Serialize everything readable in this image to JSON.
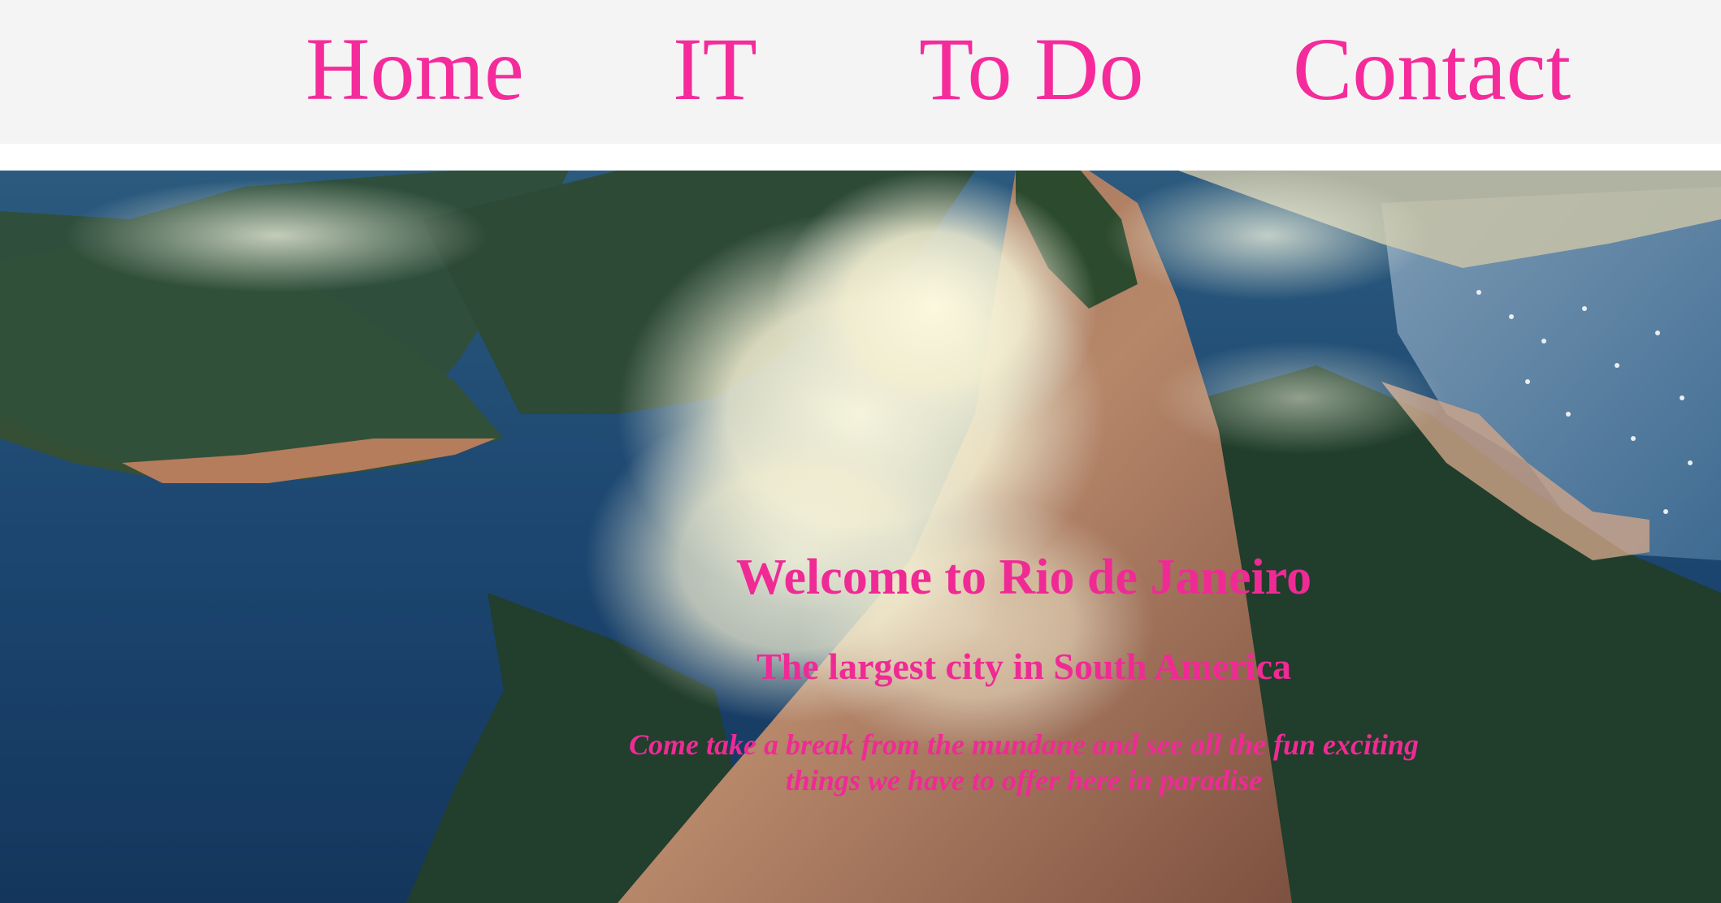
{
  "nav": {
    "home": "Home",
    "it": "IT",
    "todo": "To Do",
    "contact": "Contact"
  },
  "hero": {
    "title": "Welcome to Rio de Janeiro",
    "subtitle": "The largest city in South America",
    "tagline": "Come take a break from the mundane and see all the fun exciting things we have to offer here in paradise",
    "image": "aerial photo of Sugarloaf Mountain with clouds over the bay"
  },
  "colors": {
    "accent": "#f52b9b",
    "nav_bg": "#f4f4f4"
  }
}
